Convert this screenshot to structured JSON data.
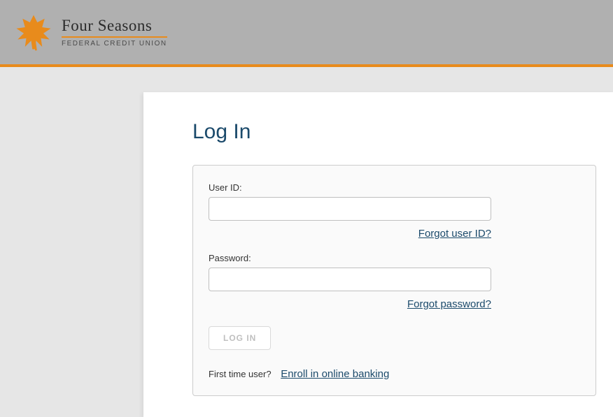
{
  "brand": {
    "name": "Four Seasons",
    "subtitle": "FEDERAL CREDIT UNION"
  },
  "page": {
    "title": "Log In"
  },
  "form": {
    "userid_label": "User ID:",
    "userid_value": "",
    "forgot_userid": "Forgot user ID?",
    "password_label": "Password:",
    "password_value": "",
    "forgot_password": "Forgot password?",
    "login_button": "LOG IN",
    "first_time_prompt": "First time user?",
    "enroll_link": "Enroll in online banking"
  },
  "colors": {
    "accent": "#e88b1c",
    "heading": "#1b4a6b",
    "link": "#1b4a6b"
  }
}
